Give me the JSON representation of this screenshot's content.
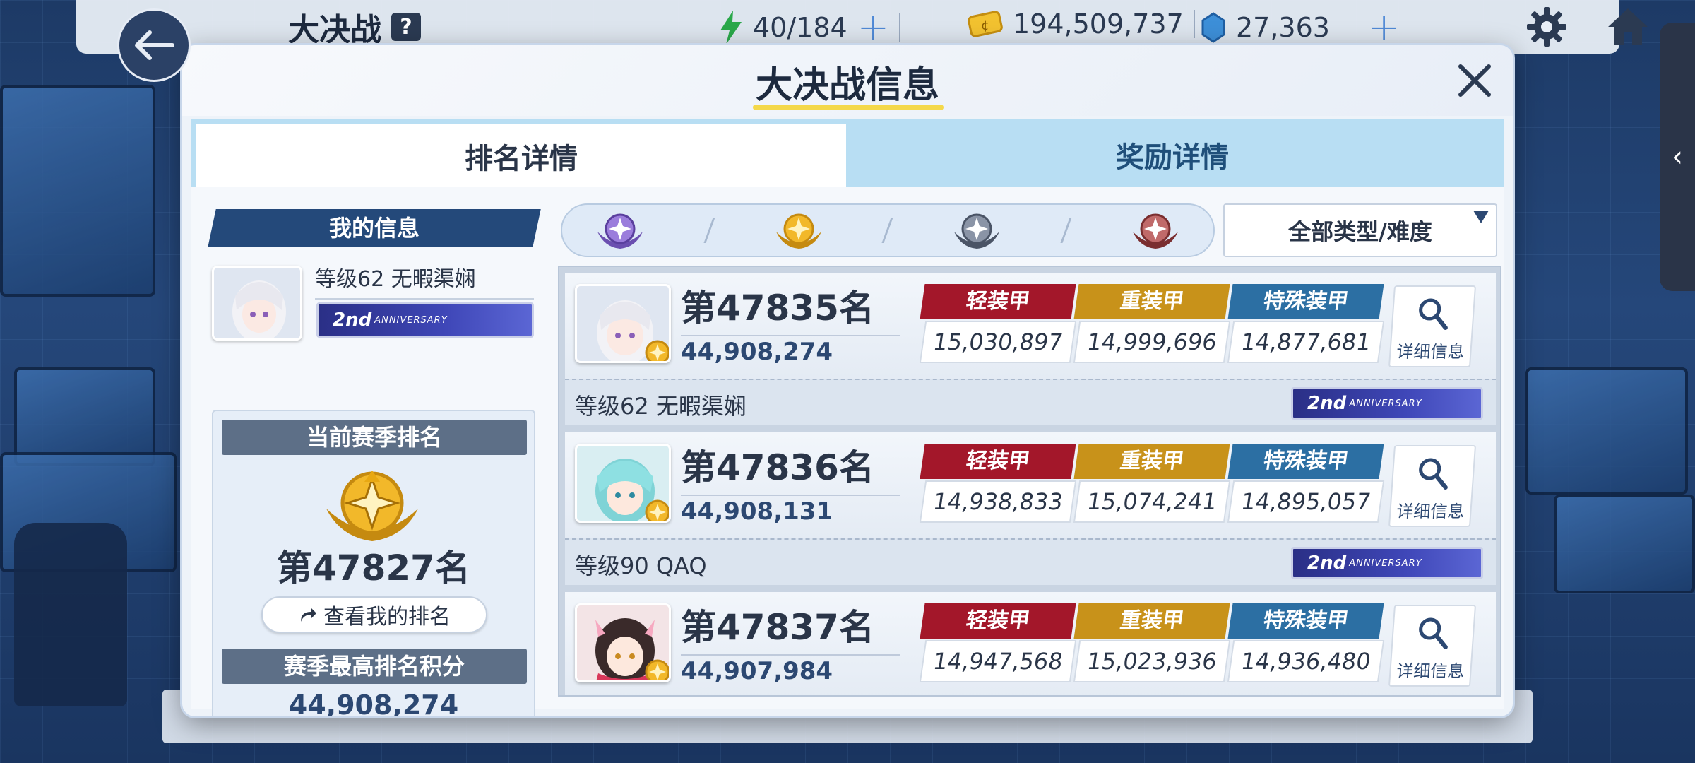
{
  "header": {
    "title": "大决战",
    "help": "?",
    "stamina": "40/184",
    "credits": "194,509,737",
    "gems": "27,363"
  },
  "dialog": {
    "title": "大决战信息",
    "tabs": {
      "rank": "排名详情",
      "reward": "奖励详情"
    }
  },
  "my_info": {
    "header": "我的信息",
    "name": "等级62 无暇渠娴",
    "current_rank_label": "当前赛季排名",
    "current_rank": "第47827名",
    "view_my_rank": "查看我的排名",
    "best_score_label": "赛季最高排名积分",
    "best_score": "44,908,274"
  },
  "badge": {
    "big": "2nd",
    "small": "ANNIVERSARY"
  },
  "filter": {
    "type_select": "全部类型/难度"
  },
  "armor_labels": {
    "light": "轻装甲",
    "heavy": "重装甲",
    "special": "特殊装甲"
  },
  "detail_label": "详细信息",
  "rows": [
    {
      "rank": "第47835名",
      "score": "44,908,274",
      "light": "15,030,897",
      "heavy": "14,999,696",
      "special": "14,877,681",
      "name": "等级62 无暇渠娴"
    },
    {
      "rank": "第47836名",
      "score": "44,908,131",
      "light": "14,938,833",
      "heavy": "15,074,241",
      "special": "14,895,057",
      "name": "等级90 QAQ"
    },
    {
      "rank": "第47837名",
      "score": "44,907,984",
      "light": "14,947,568",
      "heavy": "15,023,936",
      "special": "14,936,480",
      "name": ""
    }
  ],
  "colors": {
    "light": "#a3172a",
    "heavy": "#c8921a",
    "special": "#2c6fa3",
    "gold": "#e8a813"
  }
}
